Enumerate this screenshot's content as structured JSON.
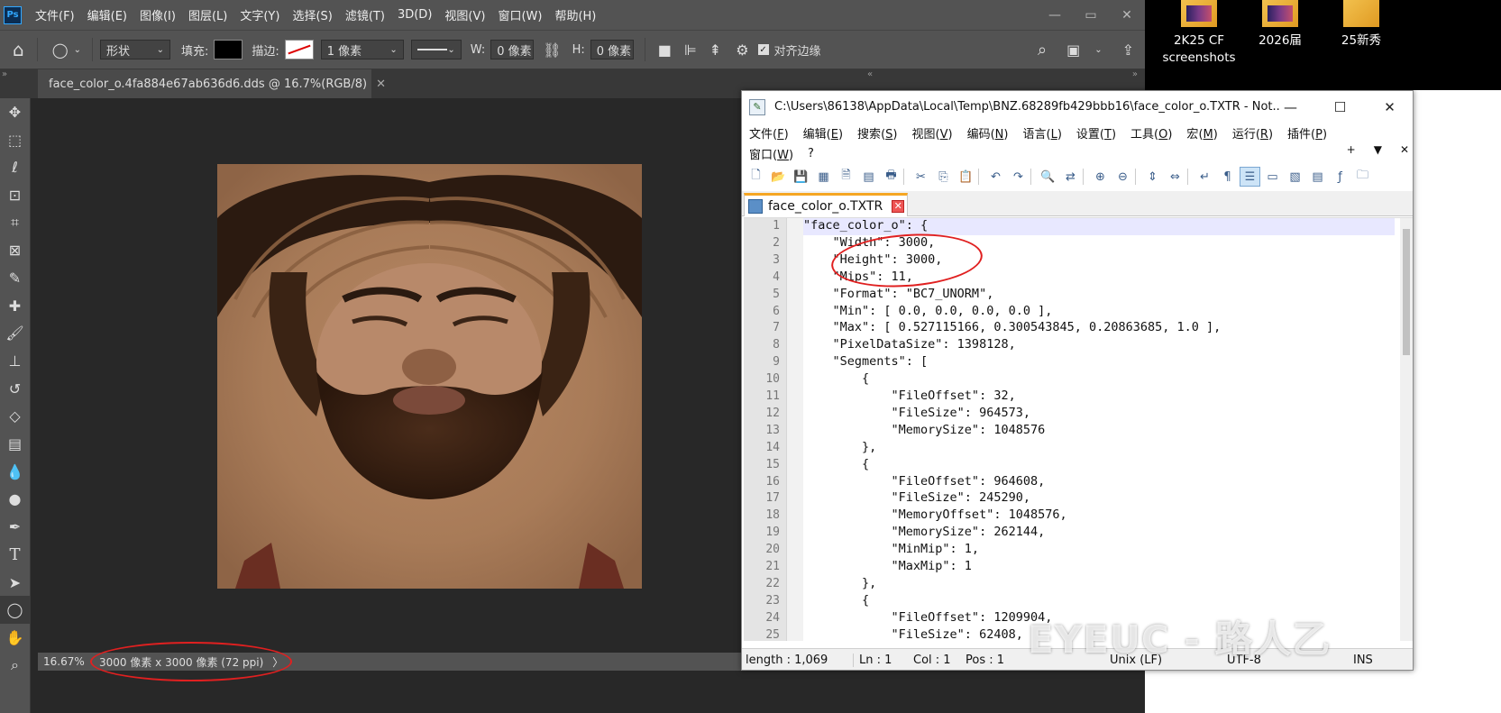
{
  "photoshop": {
    "logo": "Ps",
    "menu": [
      "文件(F)",
      "编辑(E)",
      "图像(I)",
      "图层(L)",
      "文字(Y)",
      "选择(S)",
      "滤镜(T)",
      "3D(D)",
      "视图(V)",
      "窗口(W)",
      "帮助(H)"
    ],
    "options": {
      "shape_mode": "形状",
      "fill_label": "填充:",
      "stroke_label": "描边:",
      "stroke_width": "1 像素",
      "w_label": "W:",
      "w_value": "0 像素",
      "h_label": "H:",
      "h_value": "0 像素",
      "align_edges": "对齐边缘"
    },
    "document_tab": "face_color_o.4fa884e67ab636d6.dds @ 16.7%(RGB/8)",
    "status": {
      "zoom": "16.67%",
      "dimensions": "3000 像素 x 3000 像素 (72 ppi)",
      "arrow": "〉"
    },
    "tools": [
      "move-icon",
      "marquee-icon",
      "lasso-icon",
      "object-select-icon",
      "crop-icon",
      "frame-icon",
      "eyedropper-icon",
      "healing-brush-icon",
      "brush-icon",
      "stamp-icon",
      "history-brush-icon",
      "eraser-icon",
      "gradient-icon",
      "blur-icon",
      "dodge-icon",
      "pen-icon",
      "type-icon",
      "path-select-icon",
      "ellipse-icon",
      "hand-icon",
      "zoom-icon"
    ]
  },
  "notepad": {
    "title": "C:\\Users\\86138\\AppData\\Local\\Temp\\BNZ.68289fb429bbb16\\face_color_o.TXTR - Not...",
    "menu_row1": [
      {
        "label": "文件",
        "key": "F"
      },
      {
        "label": "编辑",
        "key": "E"
      },
      {
        "label": "搜索",
        "key": "S"
      },
      {
        "label": "视图",
        "key": "V"
      },
      {
        "label": "编码",
        "key": "N"
      },
      {
        "label": "语言",
        "key": "L"
      },
      {
        "label": "设置",
        "key": "T"
      },
      {
        "label": "工具",
        "key": "O"
      },
      {
        "label": "宏",
        "key": "M"
      },
      {
        "label": "运行",
        "key": "R"
      },
      {
        "label": "插件",
        "key": "P"
      }
    ],
    "menu_row2": [
      {
        "label": "窗口",
        "key": "W"
      },
      {
        "label": "?",
        "key": ""
      }
    ],
    "menu_row2_right": [
      "+",
      "▼",
      "✕"
    ],
    "tab_name": "face_color_o.TXTR",
    "lines": [
      {
        "n": "1",
        "t": "\"face_color_o\": {"
      },
      {
        "n": "2",
        "t": "    \"Width\": 3000,"
      },
      {
        "n": "3",
        "t": "    \"Height\": 3000,"
      },
      {
        "n": "4",
        "t": "    \"Mips\": 11,"
      },
      {
        "n": "5",
        "t": "    \"Format\": \"BC7_UNORM\","
      },
      {
        "n": "6",
        "t": "    \"Min\": [ 0.0, 0.0, 0.0, 0.0 ],"
      },
      {
        "n": "7",
        "t": "    \"Max\": [ 0.527115166, 0.300543845, 0.20863685, 1.0 ],"
      },
      {
        "n": "8",
        "t": "    \"PixelDataSize\": 1398128,"
      },
      {
        "n": "9",
        "t": "    \"Segments\": ["
      },
      {
        "n": "10",
        "t": "        {"
      },
      {
        "n": "11",
        "t": "            \"FileOffset\": 32,"
      },
      {
        "n": "12",
        "t": "            \"FileSize\": 964573,"
      },
      {
        "n": "13",
        "t": "            \"MemorySize\": 1048576"
      },
      {
        "n": "14",
        "t": "        },"
      },
      {
        "n": "15",
        "t": "        {"
      },
      {
        "n": "16",
        "t": "            \"FileOffset\": 964608,"
      },
      {
        "n": "17",
        "t": "            \"FileSize\": 245290,"
      },
      {
        "n": "18",
        "t": "            \"MemoryOffset\": 1048576,"
      },
      {
        "n": "19",
        "t": "            \"MemorySize\": 262144,"
      },
      {
        "n": "20",
        "t": "            \"MinMip\": 1,"
      },
      {
        "n": "21",
        "t": "            \"MaxMip\": 1"
      },
      {
        "n": "22",
        "t": "        },"
      },
      {
        "n": "23",
        "t": "        {"
      },
      {
        "n": "24",
        "t": "            \"FileOffset\": 1209904,"
      },
      {
        "n": "25",
        "t": "            \"FileSize\": 62408,"
      }
    ],
    "status": {
      "length": "length : 1,069",
      "ln": "Ln : 1",
      "col": "Col : 1",
      "pos": "Pos : 1",
      "eol": "Unix (LF)",
      "encoding": "UTF-8",
      "ins": "INS"
    }
  },
  "desktop": {
    "icons": [
      {
        "label": "2K25 CF screenshots",
        "icon": "folder-image-icon"
      },
      {
        "label": "2026届",
        "icon": "folder-image-icon"
      },
      {
        "label": "25新秀",
        "icon": "folder-icon"
      }
    ]
  },
  "watermark": "EYEUC - 路人乙",
  "colors": {
    "annotation": "#e02020",
    "ps_panel": "#535353",
    "ps_bg": "#282828",
    "npp_tab_accent": "#f5a623"
  }
}
